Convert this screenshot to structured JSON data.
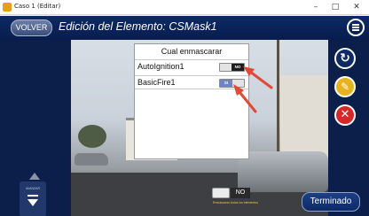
{
  "window": {
    "title": "Caso 1 (Editar)",
    "controls": {
      "minimize": "–",
      "maximize": "□",
      "close": "✕"
    }
  },
  "header": {
    "back_label": "VOLVER",
    "title": "Edición del Elemento: CSMask1"
  },
  "dialog": {
    "title": "Cual enmascarar",
    "rows": [
      {
        "label": "AutoIgnition1",
        "toggle_text": "NO",
        "state": "off"
      },
      {
        "label": "BasicFire1",
        "toggle_text": "SI",
        "state": "on"
      }
    ]
  },
  "left_controls": {
    "speed_label": "AVANZAR"
  },
  "bottom": {
    "toggle_text": "NO",
    "caption": "Enmascarar todos los elementos",
    "done_label": "Terminado"
  },
  "icons": {
    "add": "add-circle-icon",
    "edit": "pencil-eraser-icon",
    "delete": "delete-x-icon",
    "menu": "hamburger-menu-icon",
    "arrow_up": "arrow-up-icon",
    "arrow_down": "arrow-down-icon"
  },
  "colors": {
    "header": "#0d2a66",
    "annotation": "#e04a36",
    "toggle_on": "#6f84c2",
    "toggle_off": "#1c1c1c",
    "delete": "#d62828",
    "edit": "#e6b31e"
  }
}
